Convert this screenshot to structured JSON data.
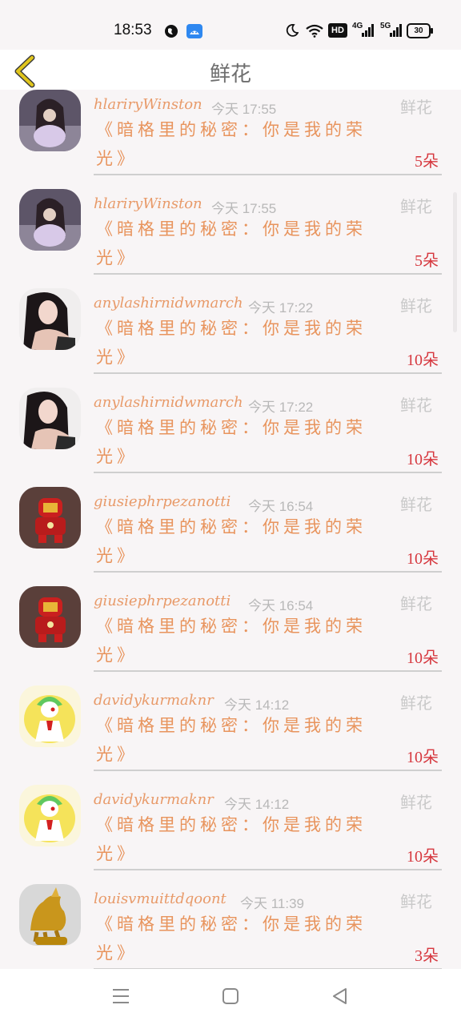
{
  "status_bar": {
    "time": "18:53",
    "icons": [
      "globe-icon",
      "android-icon",
      "moon-icon",
      "wifi-icon",
      "hd-icon",
      "signal-4g-icon",
      "signal-5g-icon",
      "battery-icon"
    ],
    "hd_label": "HD",
    "net1": "4G",
    "net2": "5G",
    "battery": "30"
  },
  "header": {
    "title": "鲜花",
    "back_icon": "chevron-left-icon",
    "accent": "#e0c51c"
  },
  "items": [
    {
      "user": "hlariryWinston",
      "time": "今天 17:55",
      "tag": "鲜花",
      "message": "《暗格里的秘密：你是我的荣光》",
      "count": "5朵"
    },
    {
      "user": "hlariryWinston",
      "time": "今天 17:55",
      "tag": "鲜花",
      "message": "《暗格里的秘密：你是我的荣光》",
      "count": "5朵"
    },
    {
      "user": "anylashirnidwmarch",
      "time": "今天 17:22",
      "tag": "鲜花",
      "message": "《暗格里的秘密：你是我的荣光》",
      "count": "10朵"
    },
    {
      "user": "anylashirnidwmarch",
      "time": "今天 17:22",
      "tag": "鲜花",
      "message": "《暗格里的秘密：你是我的荣光》",
      "count": "10朵"
    },
    {
      "user": "giusiephrpezanotti",
      "time": "今天 16:54",
      "tag": "鲜花",
      "message": "《暗格里的秘密：你是我的荣光》",
      "count": "10朵"
    },
    {
      "user": "giusiephrpezanotti",
      "time": "今天 16:54",
      "tag": "鲜花",
      "message": "《暗格里的秘密：你是我的荣光》",
      "count": "10朵"
    },
    {
      "user": "davidykurmaknr",
      "time": "今天 14:12",
      "tag": "鲜花",
      "message": "《暗格里的秘密：你是我的荣光》",
      "count": "10朵"
    },
    {
      "user": "davidykurmaknr",
      "time": "今天 14:12",
      "tag": "鲜花",
      "message": "《暗格里的秘密：你是我的荣光》",
      "count": "10朵"
    },
    {
      "user": "louisvmuittdqoont",
      "time": "今天 11:39",
      "tag": "鲜花",
      "message": "《暗格里的秘密：你是我的荣光》",
      "count": "3朵"
    }
  ],
  "nav_bar": {
    "icons": [
      "menu-icon",
      "home-icon",
      "back-icon"
    ]
  },
  "colors": {
    "message": "#e8945d",
    "username": "#e89a69",
    "count": "#d6373e",
    "time": "#b8b8b8"
  }
}
